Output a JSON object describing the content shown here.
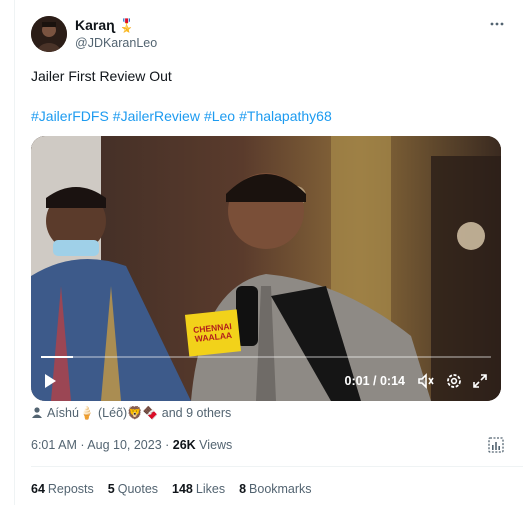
{
  "author": {
    "display_name": "Karaɳ",
    "medal": "🎖️",
    "handle": "@JDKaranLeo"
  },
  "tweet": {
    "text": "Jailer First Review Out",
    "hashtags": [
      "#JailerFDFS",
      "#JailerReview",
      "#Leo",
      "#Thalapathy68"
    ]
  },
  "video": {
    "time_current": "0:01",
    "time_total": "0:14",
    "timecode": "0:01 / 0:14",
    "progress": 0.07,
    "mic_flag_line1": "CHENNAI",
    "mic_flag_line2": "WAALAA"
  },
  "liked_by": {
    "text": "Aíshú🍦 (Léõ)🦁🍫 and 9 others"
  },
  "meta": {
    "time": "6:01 AM · Aug 10, 2023 · ",
    "views_count": "26K",
    "views_label": " Views"
  },
  "stats": {
    "reposts_count": "64",
    "reposts_label": "Reposts",
    "quotes_count": "5",
    "quotes_label": "Quotes",
    "likes_count": "148",
    "likes_label": "Likes",
    "bookmarks_count": "8",
    "bookmarks_label": "Bookmarks"
  },
  "icons": {
    "more": "more-horizontal-icon",
    "play": "play-icon",
    "volume": "volume-muted-icon",
    "settings": "settings-icon",
    "fullscreen": "fullscreen-icon",
    "analytics": "analytics-icon",
    "person": "person-icon"
  },
  "colors": {
    "link": "#1d9bf0",
    "text": "#0f1419",
    "secondary": "#536471"
  }
}
